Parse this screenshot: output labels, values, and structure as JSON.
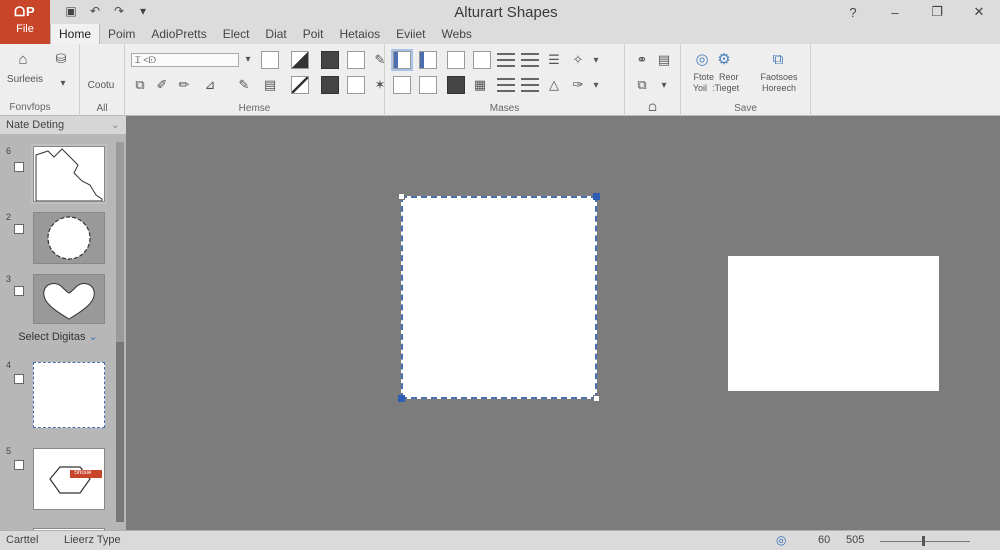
{
  "app": {
    "logo": "ᗝP",
    "file_label": "File",
    "title": "Alturart Shapes",
    "quick_access": [
      "save-icon",
      "undo-icon",
      "redo-icon",
      "customize-icon"
    ],
    "window_controls": [
      "?",
      "–",
      "❐",
      "✕"
    ]
  },
  "tabs": [
    {
      "label": "Home",
      "active": true
    },
    {
      "label": "Poim"
    },
    {
      "label": "AdioPretts"
    },
    {
      "label": "Elect"
    },
    {
      "label": "Diat"
    },
    {
      "label": "Poit"
    },
    {
      "label": "Hetaios"
    },
    {
      "label": "Eviiet"
    },
    {
      "label": "Webs"
    }
  ],
  "ribbon": {
    "groups": [
      {
        "label": "Fonvfops",
        "items": [
          {
            "label": "Surleeis"
          },
          {
            "label": "Cootu"
          }
        ]
      },
      {
        "label": "All"
      },
      {
        "label": "Hemse",
        "combo_value": "Ꮖ ˂ᗟ"
      },
      {
        "label": "Mases"
      },
      {
        "label": "ᗝ"
      },
      {
        "label": "Save",
        "items": [
          {
            "label": "Ftote  Reor\nYoil  :Tieget"
          },
          {
            "label": "Faotsoes\nHoreech"
          }
        ]
      }
    ]
  },
  "panel": {
    "title": "Nate Deting",
    "section_label": "Select Digitas",
    "slides": [
      {
        "number": "6",
        "kind": "map"
      },
      {
        "number": "2",
        "kind": "circle"
      },
      {
        "number": "3",
        "kind": "heart"
      },
      {
        "number": "4",
        "kind": "blank"
      },
      {
        "number": "5",
        "kind": "hexagon",
        "tag": "Shoue"
      }
    ]
  },
  "status": {
    "left": "Carttel",
    "mode": "Lieerz Type",
    "view_icon": "globe-icon",
    "page_value": "60",
    "zoom_value": "505"
  },
  "colors": {
    "accent": "#c9452a",
    "selection": "#4a6fb0",
    "canvas": "#7c7c7c"
  }
}
